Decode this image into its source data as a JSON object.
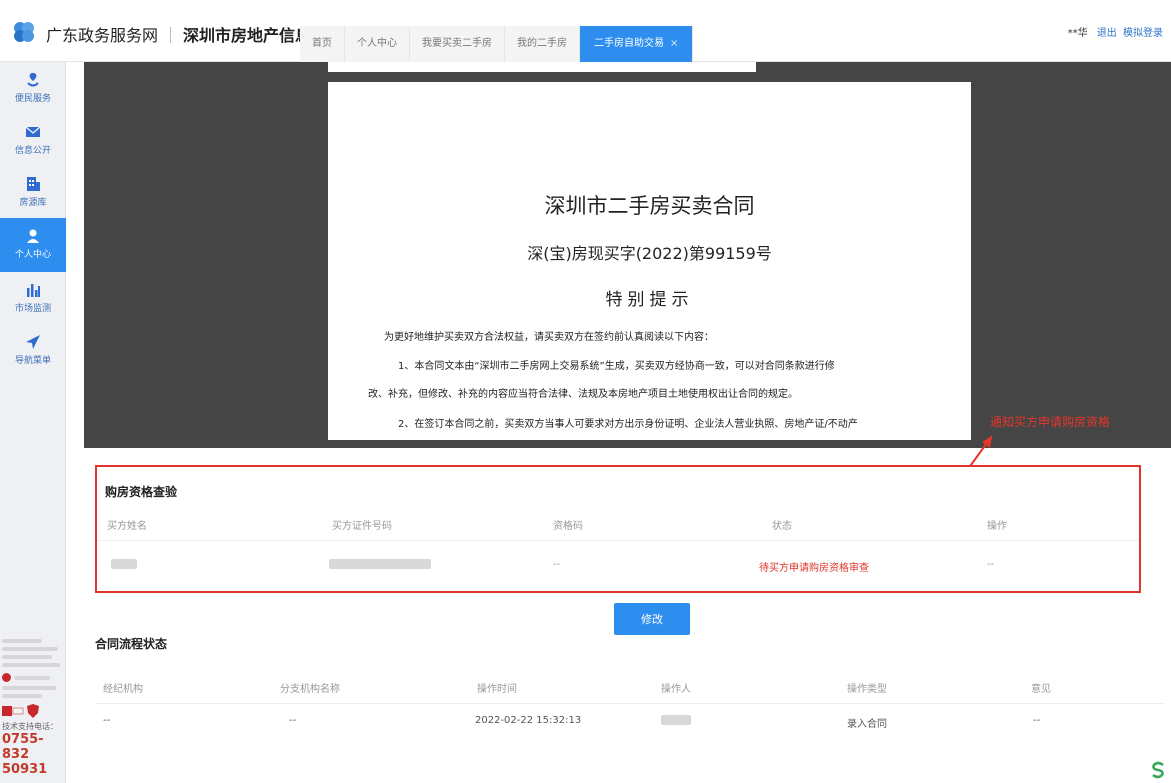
{
  "header": {
    "portal": "广东政务服务网",
    "platform": "深圳市房地产信息平台",
    "tabs": [
      {
        "label": "首页"
      },
      {
        "label": "个人中心"
      },
      {
        "label": "我要买卖二手房"
      },
      {
        "label": "我的二手房"
      },
      {
        "label": "二手房自助交易",
        "close": "×"
      }
    ],
    "user_name": "**华",
    "logout": "退出",
    "sim_login": "模拟登录"
  },
  "sidebar": {
    "items": [
      {
        "label": "便民服务",
        "icon": "service-icon"
      },
      {
        "label": "信息公开",
        "icon": "mail-icon"
      },
      {
        "label": "房源库",
        "icon": "building-icon"
      },
      {
        "label": "个人中心",
        "icon": "user-icon"
      },
      {
        "label": "市场监测",
        "icon": "chart-icon"
      },
      {
        "label": "导航菜单",
        "icon": "nav-icon"
      }
    ],
    "tech_support_label": "技术支持电话：",
    "phone_line1": "0755-832",
    "phone_line2": "50931"
  },
  "document": {
    "title": "深圳市二手房买卖合同",
    "number": "深(宝)房现买字(2022)第99159号",
    "notice_title": "特别提示",
    "para1": "为更好地维护买卖双方合法权益，请买卖双方在签约前认真阅读以下内容：",
    "para2a": "1、本合同文本由“深圳市二手房网上交易系统”生成，买卖双方经协商一致，可以对合同条款进行修",
    "para2b": "改、补充，但修改、补充的内容应当符合法律、法规及本房地产项目土地使用权出让合同的规定。",
    "para3": "2、在签订本合同之前，买卖双方当事人可要求对方出示身份证明、企业法人营业执照、房地产证/不动产"
  },
  "annotation": {
    "note": "通知买方申请购房资格",
    "color": "#e5362a"
  },
  "qualification": {
    "title": "购房资格查验",
    "columns": [
      "买方姓名",
      "买方证件号码",
      "资格码",
      "状态",
      "操作"
    ],
    "row": {
      "qual_code": "--",
      "status": "待买方申请购房资格审查",
      "action": "--"
    }
  },
  "edit_button": "修改",
  "process": {
    "title": "合同流程状态",
    "columns": [
      "经纪机构",
      "分支机构名称",
      "操作时间",
      "操作人",
      "操作类型",
      "意见"
    ],
    "row": {
      "agency": "--",
      "branch": "--",
      "time": "2022-02-22 15:32:13",
      "op_type": "录入合同",
      "opinion": "--"
    }
  },
  "colors": {
    "accent": "#2e8ef0",
    "alert": "#e0342c",
    "doc_bg": "#454545"
  }
}
